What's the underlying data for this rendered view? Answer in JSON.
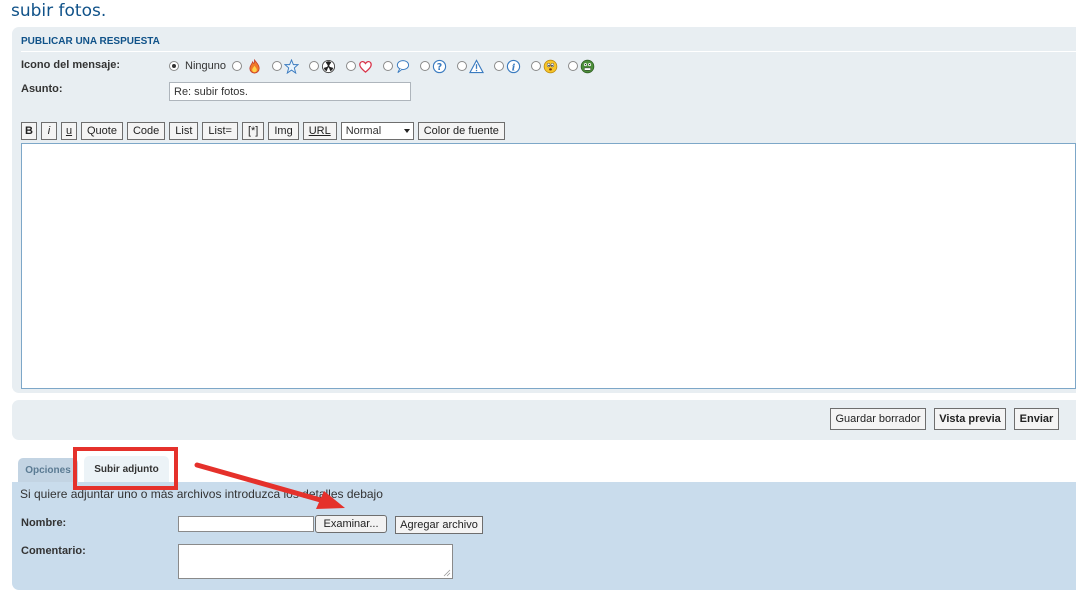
{
  "page": {
    "title": "subir fotos."
  },
  "reply_panel": {
    "heading": "PUBLICAR UNA RESPUESTA",
    "icon_label": "Icono del mensaje:",
    "icon_none_label": "Ninguno",
    "icons": [
      "fire-icon",
      "star-icon",
      "radioactive-icon",
      "heart-icon",
      "speech-bubble-icon",
      "question-icon",
      "warning-icon",
      "info-icon",
      "smiley-icon",
      "frog-face-icon"
    ],
    "subject_label": "Asunto:",
    "subject_value": "Re: subir fotos."
  },
  "toolbar": {
    "bold": "B",
    "italic": "i",
    "underline": "u",
    "quote": "Quote",
    "code": "Code",
    "list": "List",
    "list_ordered": "List=",
    "list_item": "[*]",
    "img": "Img",
    "url": "URL",
    "font_size_selected": "Normal",
    "font_color": "Color de fuente"
  },
  "actions": {
    "save_draft": "Guardar borrador",
    "preview": "Vista previa",
    "submit": "Enviar"
  },
  "tabs": {
    "options": "Opciones",
    "upload": "Subir adjunto"
  },
  "attachments": {
    "info": "Si quiere adjuntar uno o más archivos introduzca los detalles debajo",
    "name_label": "Nombre:",
    "browse": "Examinar...",
    "add_file": "Agregar archivo",
    "comment_label": "Comentario:"
  },
  "colors": {
    "title_blue": "#105289",
    "panel_bg": "#e8eef2",
    "attach_bg": "#c9dcec",
    "annotation_red": "#e5312b"
  }
}
